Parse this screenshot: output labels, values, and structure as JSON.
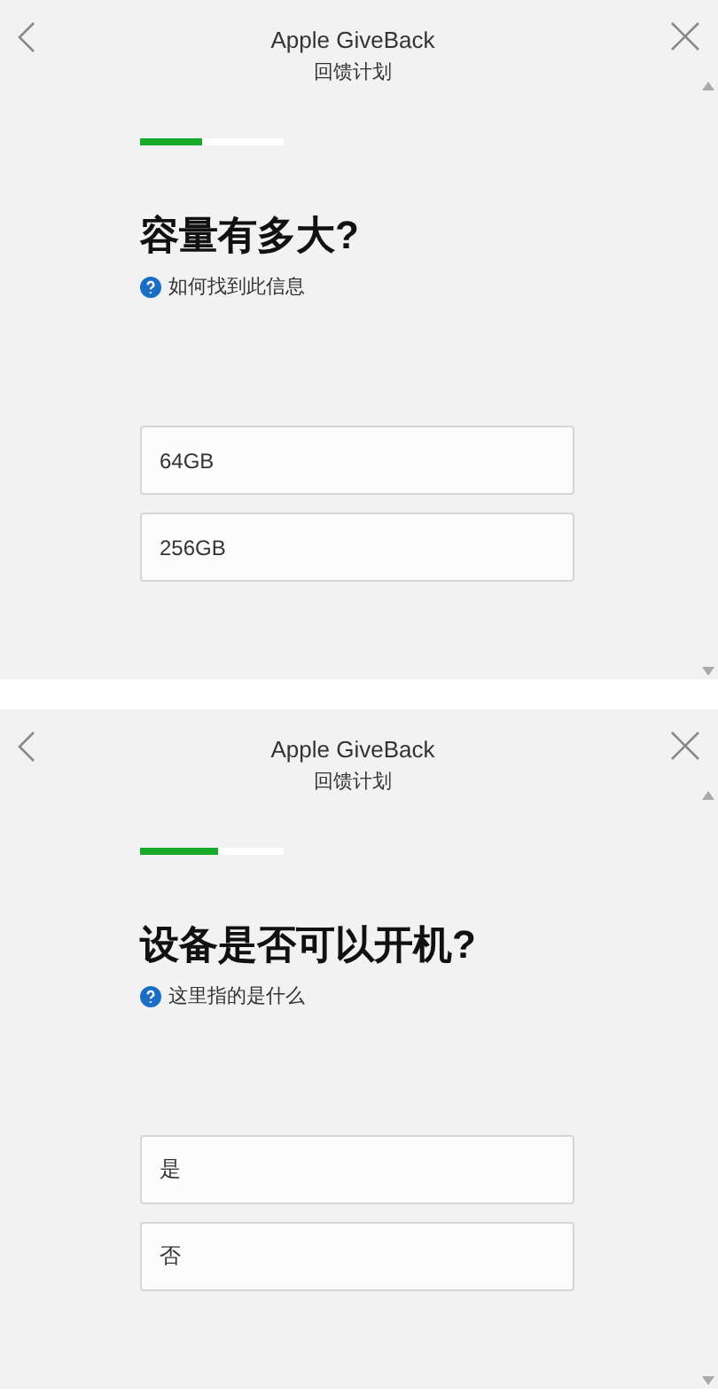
{
  "panels": [
    {
      "title": "Apple GiveBack",
      "subtitle": "回馈计划",
      "progress": {
        "level": 0.43
      },
      "question": "容量有多大?",
      "help": "如何找到此信息",
      "options": [
        "64GB",
        "256GB"
      ]
    },
    {
      "title": "Apple GiveBack",
      "subtitle": "回馈计划",
      "progress": {
        "level": 0.54
      },
      "question": "设备是否可以开机?",
      "help": "这里指的是什么",
      "options": [
        "是",
        "否"
      ]
    }
  ]
}
